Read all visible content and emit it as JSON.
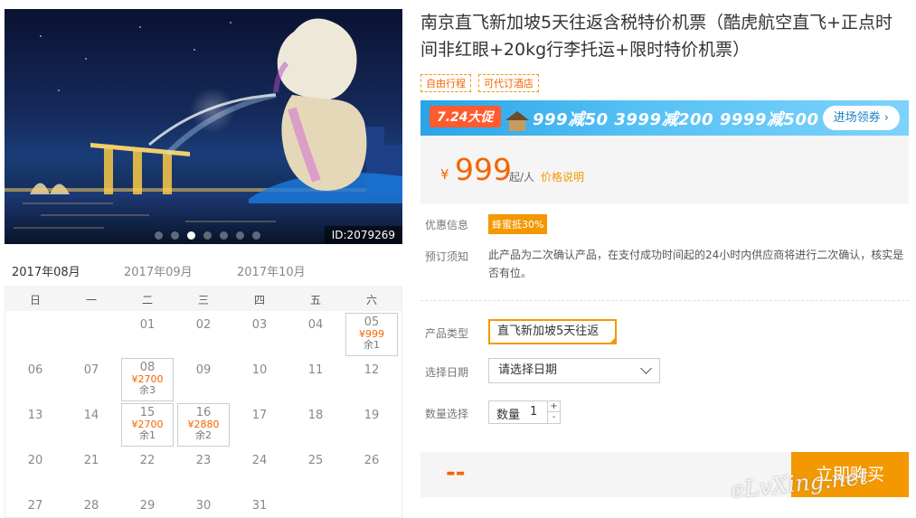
{
  "hero": {
    "image_id": "ID:2079269",
    "dots": 7,
    "active_dot": 2
  },
  "calendar": {
    "months": [
      "2017年08月",
      "2017年09月",
      "2017年10月"
    ],
    "active_month": 0,
    "weekdays": [
      "日",
      "一",
      "二",
      "三",
      "四",
      "五",
      "六"
    ],
    "weeks": [
      [
        null,
        null,
        {
          "d": "01"
        },
        {
          "d": "02"
        },
        {
          "d": "03"
        },
        {
          "d": "04"
        },
        {
          "d": "05",
          "price": "¥999",
          "rem": "余1"
        }
      ],
      [
        {
          "d": "06"
        },
        {
          "d": "07"
        },
        {
          "d": "08",
          "price": "¥2700",
          "rem": "余3"
        },
        {
          "d": "09"
        },
        {
          "d": "10"
        },
        {
          "d": "11"
        },
        {
          "d": "12"
        }
      ],
      [
        {
          "d": "13"
        },
        {
          "d": "14"
        },
        {
          "d": "15",
          "price": "¥2700",
          "rem": "余1"
        },
        {
          "d": "16",
          "price": "¥2880",
          "rem": "余2"
        },
        {
          "d": "17"
        },
        {
          "d": "18"
        },
        {
          "d": "19"
        }
      ],
      [
        {
          "d": "20"
        },
        {
          "d": "21"
        },
        {
          "d": "22"
        },
        {
          "d": "23"
        },
        {
          "d": "24"
        },
        {
          "d": "25"
        },
        {
          "d": "26"
        }
      ],
      [
        {
          "d": "27"
        },
        {
          "d": "28"
        },
        {
          "d": "29"
        },
        {
          "d": "30"
        },
        {
          "d": "31"
        },
        null,
        null
      ]
    ]
  },
  "product": {
    "title": "南京直飞新加坡5天往返含税特价机票（酷虎航空直飞+正点时间非红眼+20kg行李托运+限时特价机票）",
    "tags": [
      "自由行程",
      "可代订酒店"
    ]
  },
  "banner": {
    "badge": "7.24大促",
    "promo": "999减50  3999减200  9999减500",
    "button": "进场领券 ›"
  },
  "price": {
    "currency": "¥",
    "amount": "999",
    "unit": "起/人",
    "explain": "价格说明"
  },
  "info": {
    "promo_label": "优惠信息",
    "promo_badge": "蜂蜜抵30%",
    "notice_label": "预订须知",
    "notice_text": "此产品为二次确认产品，在支付成功时间起的24小时内供应商将进行二次确认，核实是否有位。"
  },
  "options": {
    "type_label": "产品类型",
    "type_value": "直飞新加坡5天往返",
    "date_label": "选择日期",
    "date_placeholder": "请选择日期",
    "qty_label": "数量选择",
    "qty_inner_label": "数量",
    "qty_value": "1",
    "plus": "+",
    "minus": "-"
  },
  "buy": {
    "total": "--",
    "button": "立即购买"
  },
  "watermark": "eLvXing.net",
  "colors": {
    "accent": "#f39800",
    "price": "#f56400"
  }
}
